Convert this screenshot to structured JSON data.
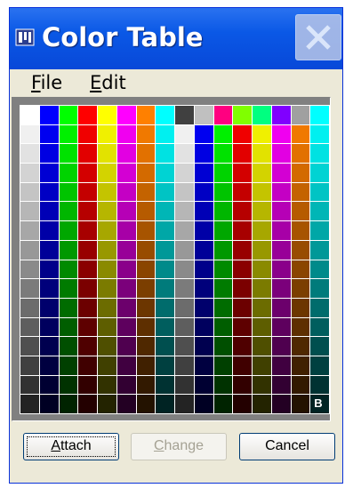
{
  "window": {
    "title": "Color Table",
    "close_label": "Close"
  },
  "menu": {
    "items": [
      {
        "label": "File",
        "mnemonic": "F"
      },
      {
        "label": "Edit",
        "mnemonic": "E"
      }
    ]
  },
  "color_grid": {
    "columns": 16,
    "rows": 16,
    "top_row": [
      "#ffffff",
      "#0000ff",
      "#00ff00",
      "#ff0000",
      "#ffff00",
      "#ff00ff",
      "#ff8000",
      "#00ffff",
      "#404040",
      "#c0c0c0",
      "#ff0080",
      "#80ff00",
      "#00ff80",
      "#8000ff",
      "#a0a0a0",
      "#00ffff"
    ],
    "column_bases": [
      "#ffffff",
      "#0000ff",
      "#00ff00",
      "#ff0000",
      "#ffff00",
      "#ff00ff",
      "#ff8000",
      "#00ffff",
      "#ffffff",
      "#0000ff",
      "#00ff00",
      "#ff0000",
      "#ffff00",
      "#ff00ff",
      "#ff8000",
      "#00ffff"
    ],
    "background_cell_label": "B"
  },
  "buttons": {
    "attach": {
      "label": "Attach",
      "mnemonic": "A",
      "enabled": true
    },
    "change": {
      "label": "Change",
      "mnemonic": "C",
      "enabled": false
    },
    "cancel": {
      "label": "Cancel",
      "enabled": true
    }
  }
}
